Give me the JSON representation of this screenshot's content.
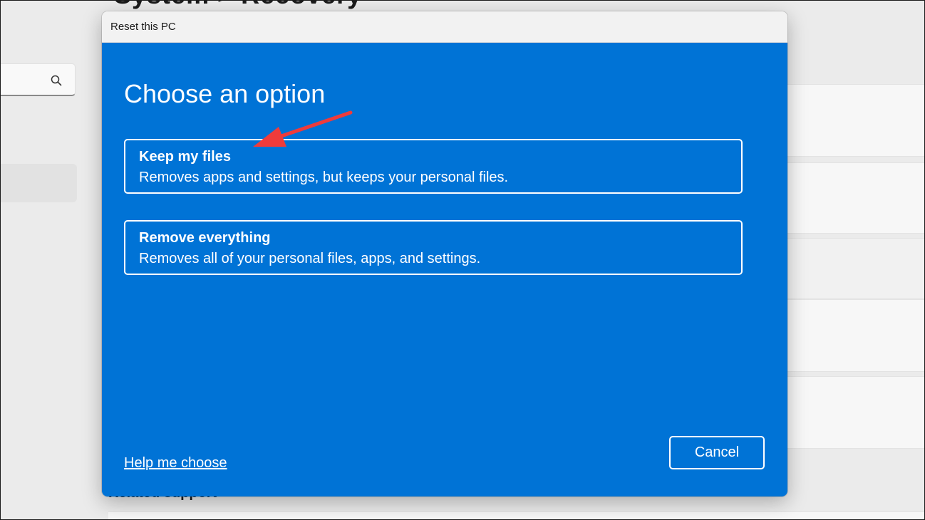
{
  "background": {
    "page_title": "System > Recovery",
    "related_support_label": "Related support"
  },
  "dialog": {
    "title": "Reset this PC",
    "heading": "Choose an option",
    "options": [
      {
        "title": "Keep my files",
        "description": "Removes apps and settings, but keeps your personal files."
      },
      {
        "title": "Remove everything",
        "description": "Removes all of your personal files, apps, and settings."
      }
    ],
    "help_link": "Help me choose",
    "cancel_label": "Cancel"
  },
  "colors": {
    "dialog_background": "#0073d6",
    "annotation_arrow": "#ef3b3b",
    "titlebar": "#f2f2f2"
  },
  "icons": {
    "search": "search-icon",
    "annotation": "red-arrow-annotation"
  }
}
